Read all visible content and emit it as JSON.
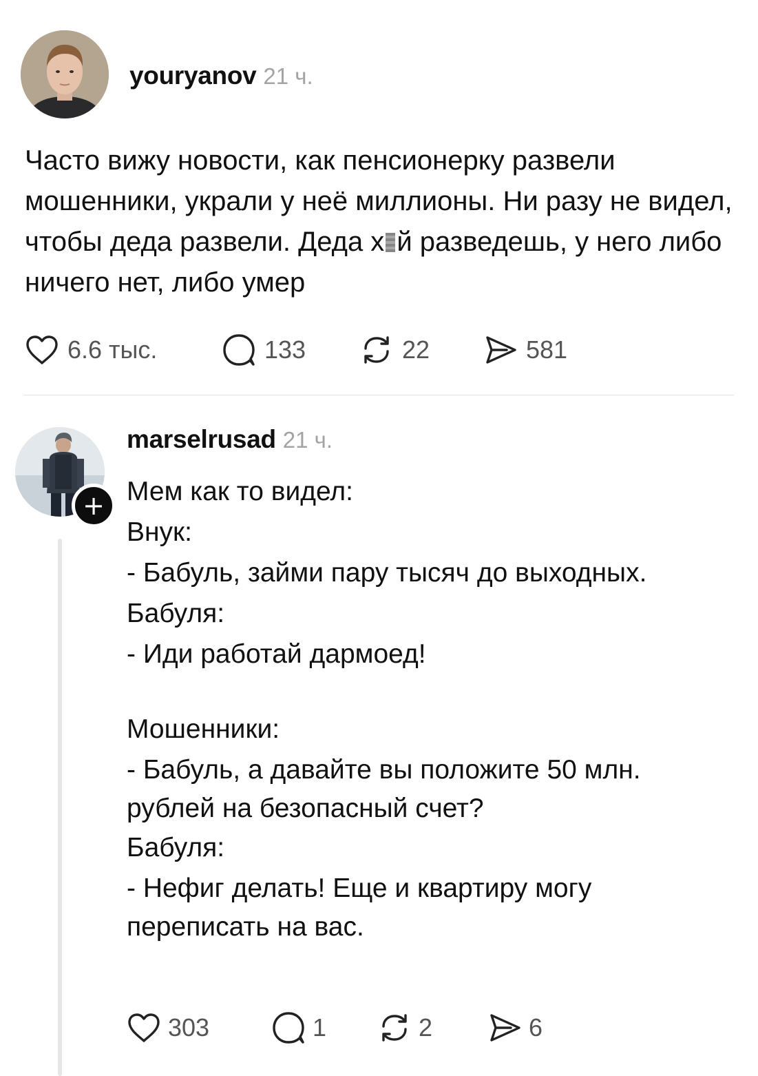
{
  "post": {
    "username": "youryanov",
    "time": "21 ч.",
    "text_before_censor": "Часто вижу новости, как пенсионерку развели мошенники, украли у неё миллионы. Ни разу не видел, чтобы деда развели. Деда х",
    "text_after_censor": "й разведешь, у него либо ничего нет, либо умер",
    "likes": "6.6 тыс.",
    "comments": "133",
    "reposts": "22",
    "shares": "581"
  },
  "reply": {
    "username": "marselrusad",
    "time": "21 ч.",
    "lines": [
      "Мем как то видел:",
      "Внук:",
      "- Бабуль, займи пару тысяч до выходных.",
      "Бабуля:",
      "- Иди работай дармоед!",
      "Мошенники:",
      "- Бабуль, а давайте вы положите 50 млн.",
      "рублей на безопасный счет?",
      "Бабуля:",
      "- Нефиг делать! Еще и квартиру могу",
      "переписать на вас."
    ],
    "likes": "303",
    "comments": "1",
    "reposts": "2",
    "shares": "6",
    "follow_badge": "+"
  },
  "icons": {
    "like": "heart-icon",
    "comment": "speech-bubble-icon",
    "repost": "repost-arrows-icon",
    "share": "paper-plane-icon",
    "follow": "plus-icon"
  }
}
